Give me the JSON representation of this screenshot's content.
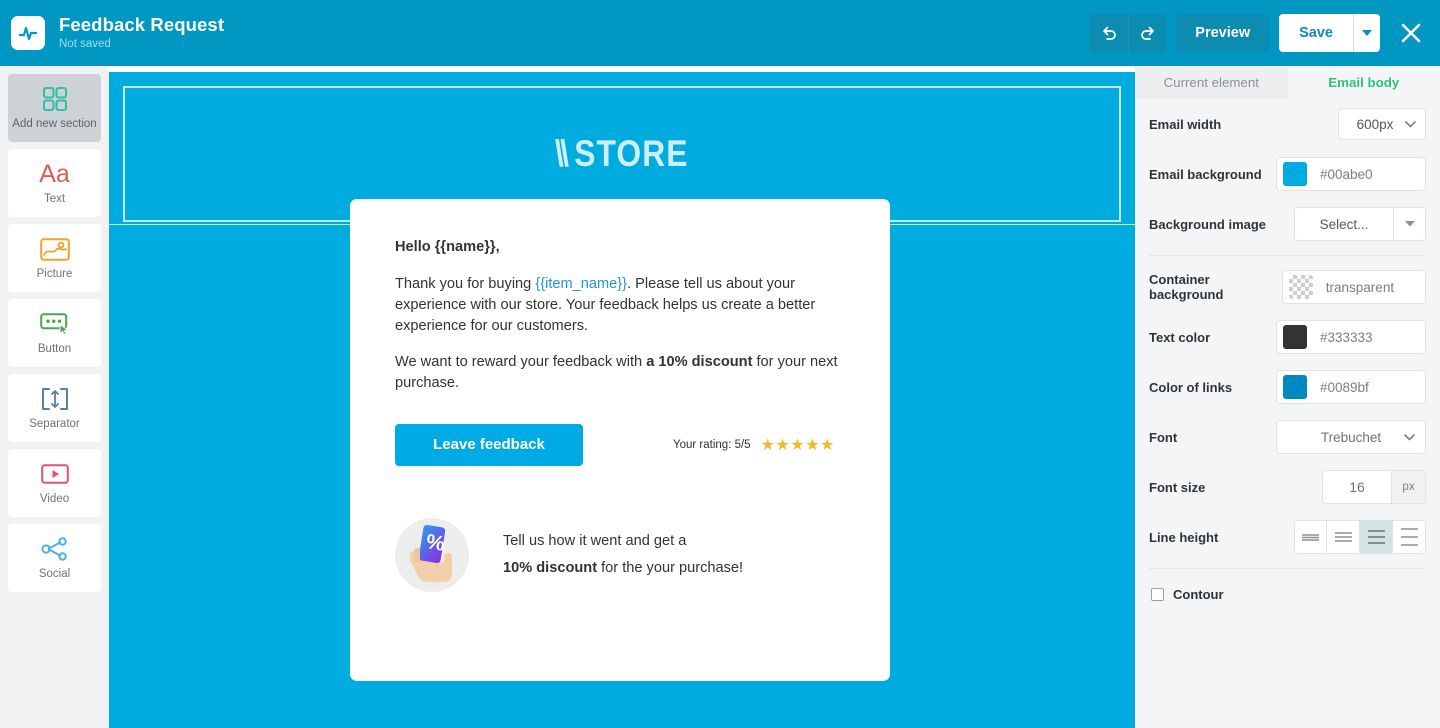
{
  "topbar": {
    "logo_icon": "pulse-icon",
    "title": "Feedback Request",
    "status": "Not saved",
    "undo_icon": "undo-arrow-icon",
    "redo_icon": "redo-arrow-icon",
    "preview_label": "Preview",
    "save_label": "Save",
    "save_caret_icon": "chevron-down-icon",
    "close_icon": "close-x-icon",
    "bg_color": "#0098c3"
  },
  "sidebar": {
    "items": [
      {
        "label": "Add new section",
        "icon": "grid-squares-icon",
        "color": "#2ebfa5",
        "selected": true
      },
      {
        "label": "Text",
        "icon": "text-aa-icon",
        "color": "#e05b4f",
        "selected": false
      },
      {
        "label": "Picture",
        "icon": "picture-icon",
        "color": "#f0a22e",
        "selected": false
      },
      {
        "label": "Button",
        "icon": "button-icon",
        "color": "#4aa64a",
        "selected": false
      },
      {
        "label": "Separator",
        "icon": "separator-icon",
        "color": "#5b7fa6",
        "selected": false
      },
      {
        "label": "Video",
        "icon": "video-play-icon",
        "color": "#e0546b",
        "selected": false
      },
      {
        "label": "Social",
        "icon": "share-nodes-icon",
        "color": "#4ab4e0",
        "selected": false
      }
    ]
  },
  "canvas": {
    "email_bg_color": "#00abe0",
    "header": {
      "logo_text": "STORE",
      "logo_slashes": "\\\\",
      "logo_color": "#cdeefb"
    },
    "email": {
      "greeting": "Hello  {{name}},",
      "paragraph2_pre": "Thank you for buying ",
      "paragraph2_link": "{{item_name}}",
      "paragraph2_post": ". Please tell us about your experience with our store. Your feedback helps us create a better experience for our customers.",
      "paragraph3_pre": "We want to reward your feedback with ",
      "paragraph3_bold": "a 10% discount",
      "paragraph3_post": " for your next purchase.",
      "cta_label": "Leave feedback",
      "rating_label": "Your rating: 5/5",
      "stars": "★★★★★",
      "star_color": "#f5b826",
      "promo_icon": "hand-holding-percent-card-icon",
      "promo_line1": "Tell us how it went and get a",
      "promo_line2_bold": "10% discount",
      "promo_line2_rest": " for the your purchase!"
    }
  },
  "panel": {
    "tabs": [
      {
        "label": "Current element",
        "active": false
      },
      {
        "label": "Email body",
        "active": true
      }
    ],
    "email_width": {
      "label": "Email width",
      "value": "600px"
    },
    "email_background": {
      "label": "Email background",
      "value": "#00abe0",
      "swatch": "#00abe0"
    },
    "background_image": {
      "label": "Background image",
      "value": "Select...",
      "caret_icon": "caret-down-icon"
    },
    "container_background": {
      "label": "Container background",
      "value": "transparent",
      "swatch": "checker"
    },
    "text_color": {
      "label": "Text color",
      "value": "#333333",
      "swatch": "#333333"
    },
    "color_of_links": {
      "label": "Color of links",
      "value": "#0089bf",
      "swatch": "#0089bf"
    },
    "font": {
      "label": "Font",
      "value": "Trebuchet"
    },
    "font_size": {
      "label": "Font size",
      "value": "16",
      "unit": "px"
    },
    "line_height": {
      "label": "Line height",
      "options": [
        "tight",
        "normal",
        "relaxed",
        "loose"
      ],
      "selected_index": 2
    },
    "contour": {
      "label": "Contour",
      "checked": false
    }
  }
}
